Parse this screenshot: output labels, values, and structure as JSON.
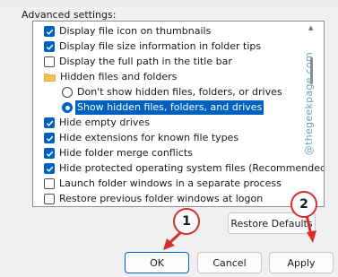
{
  "section_label": "Advanced settings:",
  "tree_items": [
    {
      "kind": "checkbox",
      "checked": true,
      "label": "Display file icon on thumbnails"
    },
    {
      "kind": "checkbox",
      "checked": true,
      "label": "Display file size information in folder tips"
    },
    {
      "kind": "checkbox",
      "checked": false,
      "label": "Display the full path in the title bar"
    },
    {
      "kind": "folder",
      "label": "Hidden files and folders"
    },
    {
      "kind": "radio",
      "checked": false,
      "label": "Don't show hidden files, folders, or drives"
    },
    {
      "kind": "radio",
      "checked": true,
      "selected": true,
      "label": "Show hidden files, folders, and drives"
    },
    {
      "kind": "checkbox",
      "checked": true,
      "label": "Hide empty drives"
    },
    {
      "kind": "checkbox",
      "checked": true,
      "label": "Hide extensions for known file types"
    },
    {
      "kind": "checkbox",
      "checked": true,
      "label": "Hide folder merge conflicts"
    },
    {
      "kind": "checkbox",
      "checked": true,
      "label": "Hide protected operating system files (Recommended)"
    },
    {
      "kind": "checkbox",
      "checked": false,
      "label": "Launch folder windows in a separate process"
    },
    {
      "kind": "checkbox",
      "checked": false,
      "label": "Restore previous folder windows at logon"
    }
  ],
  "watermark": "@thegeekpage.com",
  "buttons": {
    "restore_defaults": "Restore Defaults",
    "ok": "OK",
    "cancel": "Cancel",
    "apply": "Apply"
  },
  "annotations": {
    "badge_1": "1",
    "badge_2": "2"
  },
  "colors": {
    "accent": "#0060c0",
    "annotation": "#d32f2f"
  }
}
